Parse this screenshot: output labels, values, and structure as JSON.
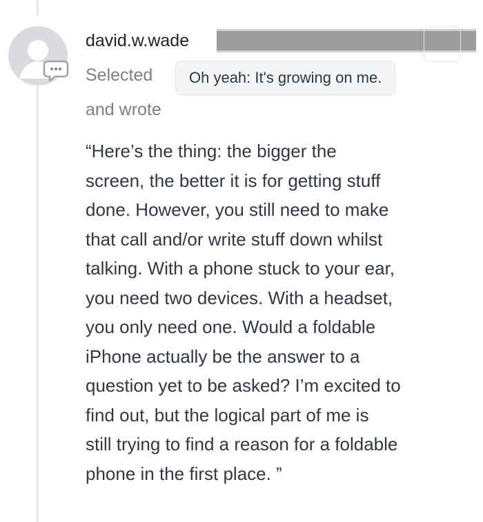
{
  "comment": {
    "username": "david.w.wade",
    "action_text": "Selected",
    "selected_text": "Oh yeah: It's growing on me.",
    "action_text_2": "and wrote",
    "quote": "“Here’s the thing: the bigger the\nscreen, the better it is for getting stuff\ndone. However, you still need to make\nthat call and/or write stuff down whilst\ntalking. With a phone stuck to your ear,\nyou need two devices. With a headset,\nyou only need one. Would a foldable\niPhone actually be the answer to a\nquestion yet to be asked? I’m excited to\nfind out, but the logical part of me is\nstill trying to find a reason for a foldable\nphone in the first place. ”"
  },
  "icons": {
    "avatar": "default-user-avatar-icon",
    "badge": "comment-bubble-icon"
  },
  "colors": {
    "text_primary": "#313744",
    "text_muted": "#7b7f88",
    "chip_background": "#f4f5f7",
    "thread_line": "#e6e7ea",
    "avatar_gray": "#d9d9dc"
  }
}
